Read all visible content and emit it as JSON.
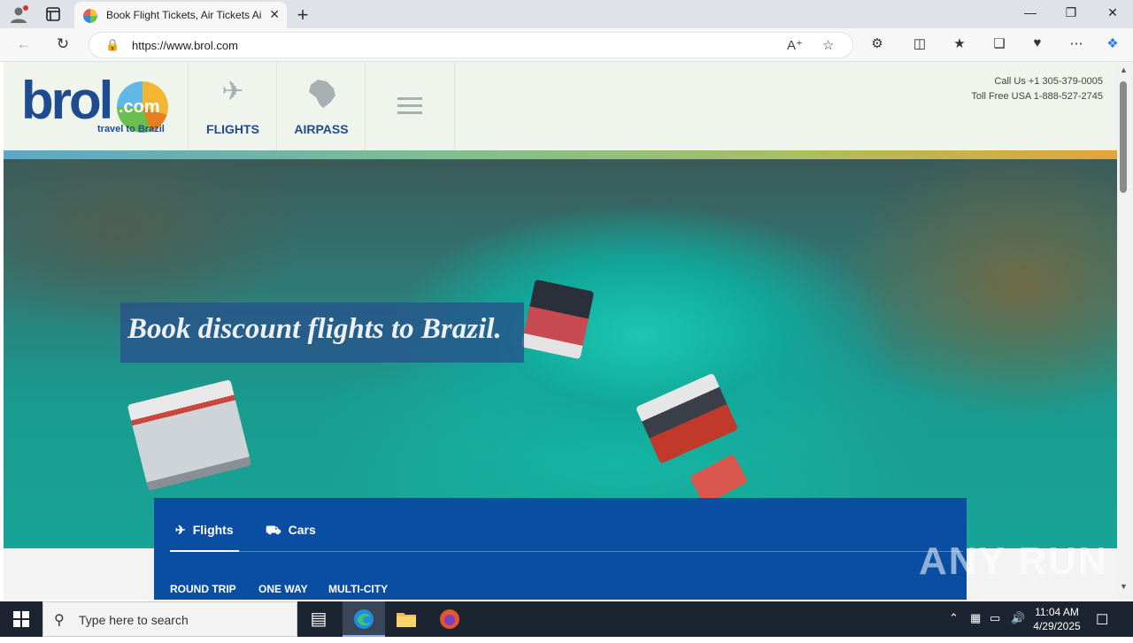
{
  "browser": {
    "tab_title": "Book Flight Tickets, Air Tickets Ai",
    "url": "https://www.brol.com",
    "new_tab_symbol": "+",
    "tab_close_symbol": "✕"
  },
  "header": {
    "logo_text": "brol",
    "logo_suffix": ".com",
    "logo_tagline": "travel to Brazil",
    "nav": [
      {
        "label": "FLIGHTS",
        "icon": "airplane-icon"
      },
      {
        "label": "AIRPASS",
        "icon": "brazil-map-icon"
      }
    ],
    "menu_icon": "hamburger-menu-icon",
    "call_us": "Call Us +1 305-379-0005",
    "toll_free": "Toll Free USA 1-888-527-2745"
  },
  "hero": {
    "headline": "Book discount flights to Brazil."
  },
  "search_panel": {
    "tabs": [
      {
        "label": "Flights",
        "icon": "airplane-icon",
        "active": true
      },
      {
        "label": "Cars",
        "icon": "car-icon",
        "active": false
      }
    ],
    "trip_types": [
      "ROUND TRIP",
      "ONE WAY",
      "MULTI-CITY"
    ]
  },
  "watermark": "ANY RUN",
  "taskbar": {
    "search_placeholder": "Type here to search",
    "time": "11:04 AM",
    "date": "4/29/2025"
  }
}
